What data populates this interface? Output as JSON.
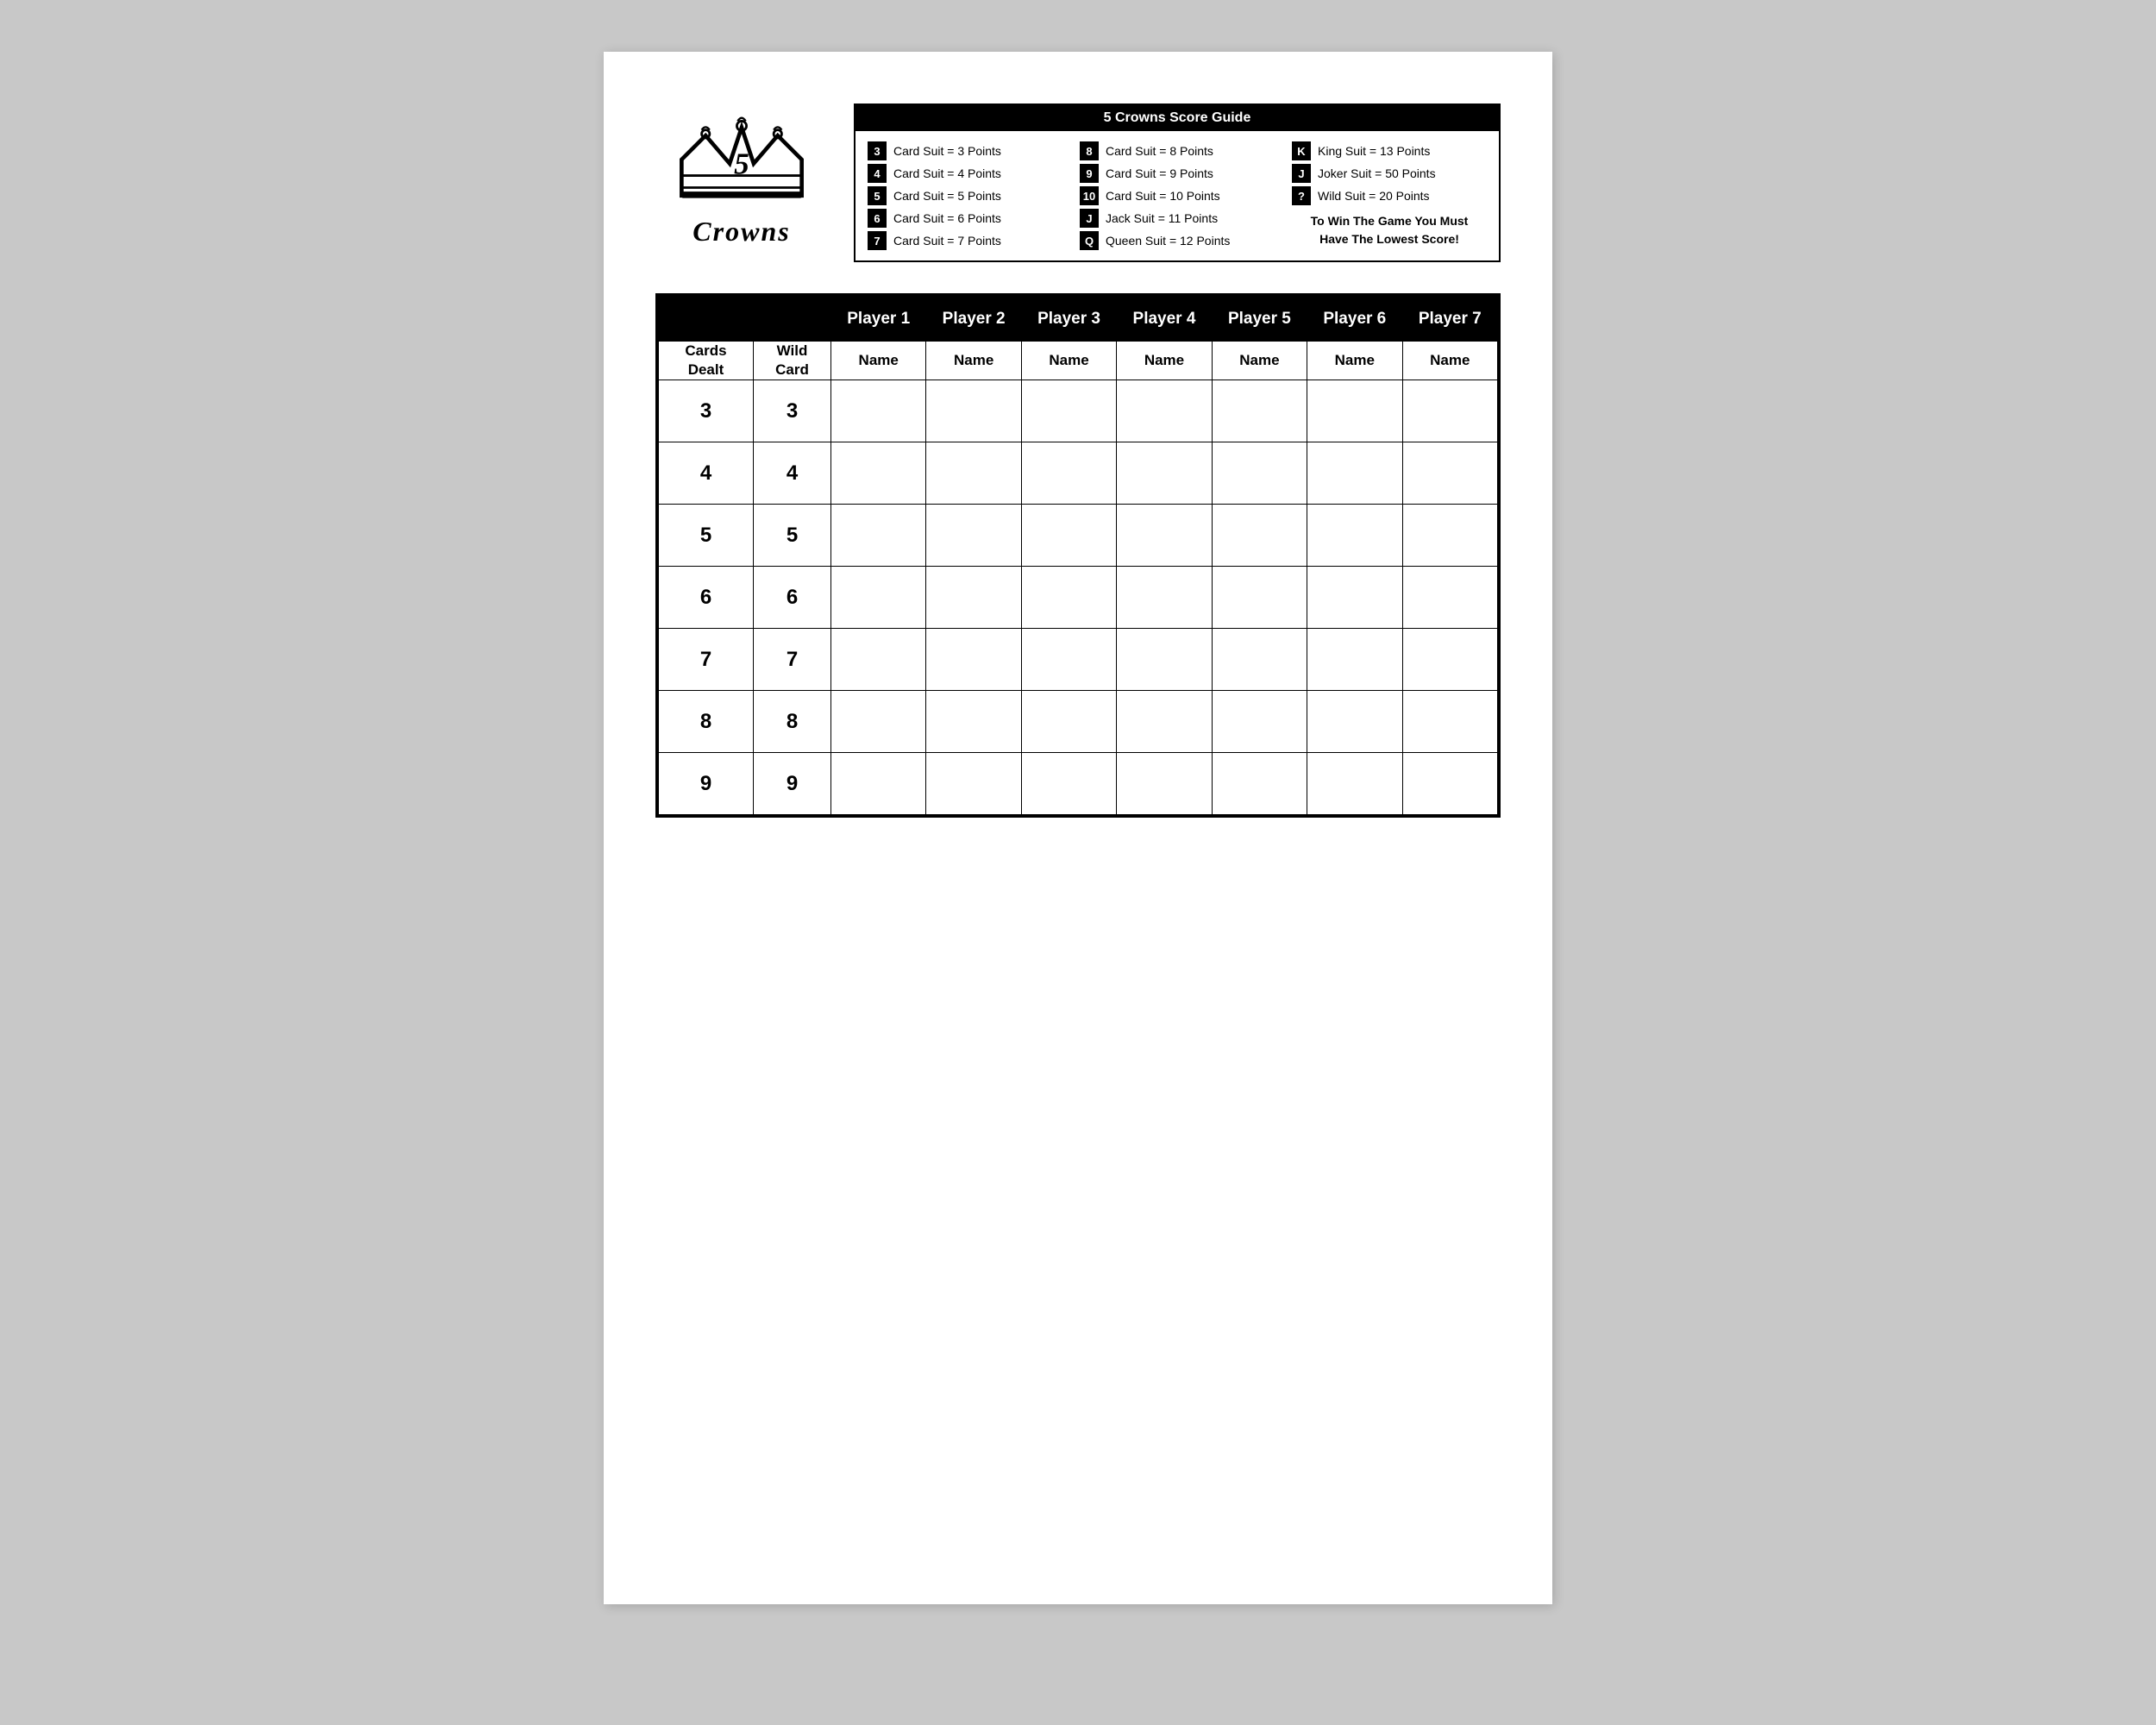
{
  "logo": {
    "title": "5",
    "subtitle": "Crowns"
  },
  "score_guide": {
    "title": "5 Crowns Score Guide",
    "items_col1": [
      {
        "badge": "3",
        "text": "Card Suit = 3 Points"
      },
      {
        "badge": "4",
        "text": "Card Suit = 4 Points"
      },
      {
        "badge": "5",
        "text": "Card Suit = 5 Points"
      },
      {
        "badge": "6",
        "text": "Card Suit = 6 Points"
      },
      {
        "badge": "7",
        "text": "Card Suit = 7 Points"
      }
    ],
    "items_col2": [
      {
        "badge": "8",
        "text": "Card Suit = 8 Points"
      },
      {
        "badge": "9",
        "text": "Card Suit = 9 Points"
      },
      {
        "badge": "10",
        "text": "Card Suit = 10 Points"
      },
      {
        "badge": "J",
        "text": "Jack Suit = 11 Points"
      },
      {
        "badge": "Q",
        "text": "Queen Suit = 12 Points"
      }
    ],
    "items_col3": [
      {
        "badge": "K",
        "text": "King Suit = 13 Points"
      },
      {
        "badge": "J",
        "text": "Joker Suit = 50 Points"
      },
      {
        "badge": "?",
        "text": "Wild Suit = 20 Points"
      }
    ],
    "win_note_line1": "To Win The Game You Must",
    "win_note_line2": "Have The Lowest Score!"
  },
  "table": {
    "players": [
      "Player 1",
      "Player 2",
      "Player 3",
      "Player 4",
      "Player 5",
      "Player 6",
      "Player 7"
    ],
    "name_row": [
      "Name",
      "Name",
      "Name",
      "Name",
      "Name",
      "Name",
      "Name"
    ],
    "col1_label": "Cards\nDealt",
    "col2_label": "Wild\nCard",
    "rows": [
      {
        "cards": "3",
        "wild": "3"
      },
      {
        "cards": "4",
        "wild": "4"
      },
      {
        "cards": "5",
        "wild": "5"
      },
      {
        "cards": "6",
        "wild": "6"
      },
      {
        "cards": "7",
        "wild": "7"
      },
      {
        "cards": "8",
        "wild": "8"
      },
      {
        "cards": "9",
        "wild": "9"
      }
    ]
  }
}
